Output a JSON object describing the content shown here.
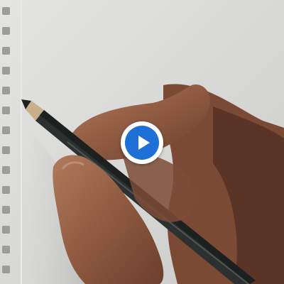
{
  "video": {
    "thumbnail_icon": "pencil-drawing-hand",
    "paused": true
  },
  "controls": {
    "play_icon": "play-icon",
    "accent_color": "#1e6fd6",
    "button_bg": "#ffffff"
  }
}
